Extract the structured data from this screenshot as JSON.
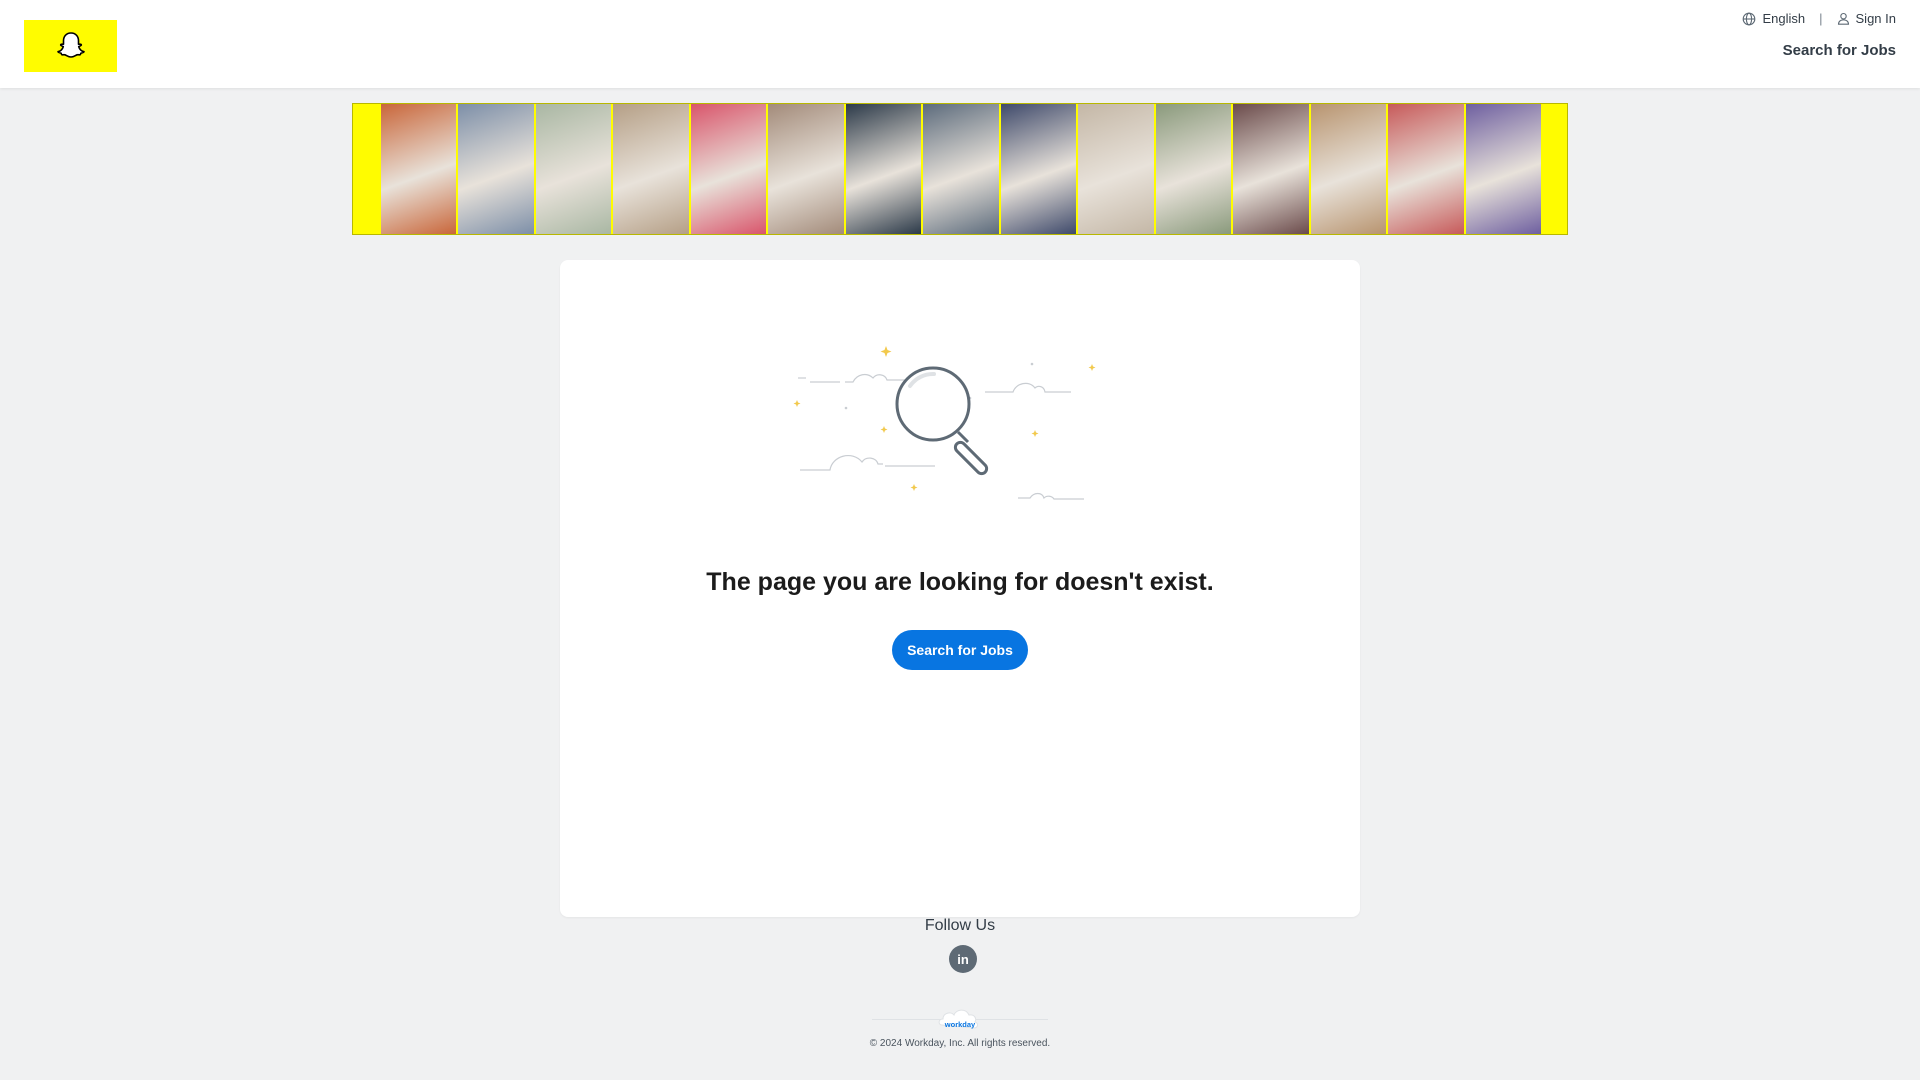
{
  "header": {
    "logo_icon": "snapchat-ghost-icon",
    "language_label": "English",
    "language_icon": "globe-icon",
    "signin_label": "Sign In",
    "signin_icon": "user-icon",
    "nav_search_label": "Search for Jobs",
    "brand_color": "#fffc00"
  },
  "banner": {
    "tile_colors": [
      "#c9663a",
      "#7d8fa8",
      "#a9b7a3",
      "#b59f86",
      "#d9556b",
      "#a38b7a",
      "#2c3a49",
      "#5c6b7c",
      "#3f4a6b",
      "#c4b7a6",
      "#8a9a7c",
      "#6b4b4b",
      "#b8946f",
      "#c75a5a",
      "#6e5fa0"
    ]
  },
  "main": {
    "error_title": "The page you are looking for doesn't exist.",
    "search_button_label": "Search for Jobs",
    "button_color": "#0875e1"
  },
  "footer": {
    "follow_label": "Follow Us",
    "linkedin_label": "in",
    "workday_label": "workday",
    "copyright": "© 2024 Workday, Inc. All rights reserved."
  }
}
